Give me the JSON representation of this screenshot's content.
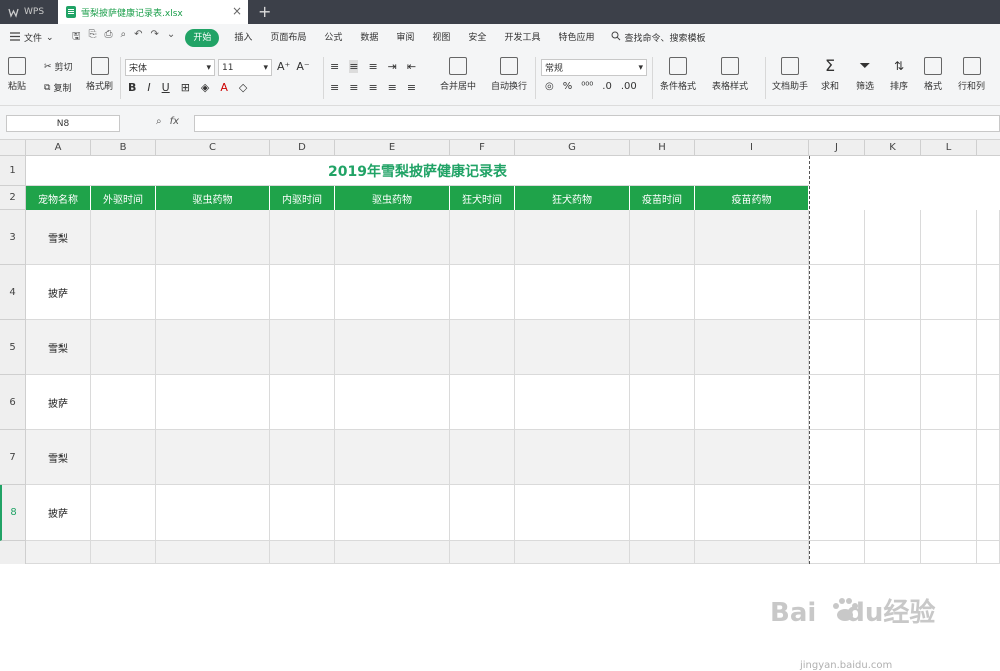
{
  "titlebar": {
    "app_name": "WPS",
    "file_tab": "雪梨披萨健康记录表.xlsx",
    "close": "×",
    "new_tab": "+"
  },
  "menubar": {
    "file_label": "文件",
    "items": [
      "开始",
      "插入",
      "页面布局",
      "公式",
      "数据",
      "审阅",
      "视图",
      "安全",
      "开发工具",
      "特色应用"
    ],
    "search": "查找命令、搜索模板"
  },
  "ribbon": {
    "paste": "粘贴",
    "cut": "剪切",
    "copy": "复制",
    "format_painter": "格式刷",
    "font_name": "宋体",
    "font_size": "11",
    "merge_center": "合并居中",
    "wrap_text": "自动换行",
    "number_format": "常规",
    "conditional_format": "条件格式",
    "table_style": "表格样式",
    "doc_helper": "文档助手",
    "sum": "求和",
    "filter": "筛选",
    "sort": "排序",
    "format": "格式",
    "rows_cols": "行和列"
  },
  "formula_bar": {
    "cell_ref": "N8",
    "fx": "fx",
    "value": ""
  },
  "sheet": {
    "columns": [
      "A",
      "B",
      "C",
      "D",
      "E",
      "F",
      "G",
      "H",
      "I",
      "J",
      "K",
      "L"
    ],
    "rows": [
      "1",
      "2",
      "3",
      "4",
      "5",
      "6",
      "7",
      "8"
    ],
    "title": "2019年雪梨披萨健康记录表",
    "headers": [
      "宠物名称",
      "外驱时间",
      "驱虫药物",
      "内驱时间",
      "驱虫药物",
      "狂犬时间",
      "狂犬药物",
      "疫苗时间",
      "疫苗药物"
    ],
    "pets": [
      "雪梨",
      "披萨",
      "雪梨",
      "披萨",
      "雪梨",
      "披萨"
    ]
  },
  "watermark": {
    "brand": "Bai",
    "brand2": "du",
    "cn": "经验",
    "url": "jingyan.baidu.com"
  },
  "colors": {
    "accent": "#21a366",
    "header_fill": "#1fa34a",
    "titlebar": "#3c4049"
  }
}
